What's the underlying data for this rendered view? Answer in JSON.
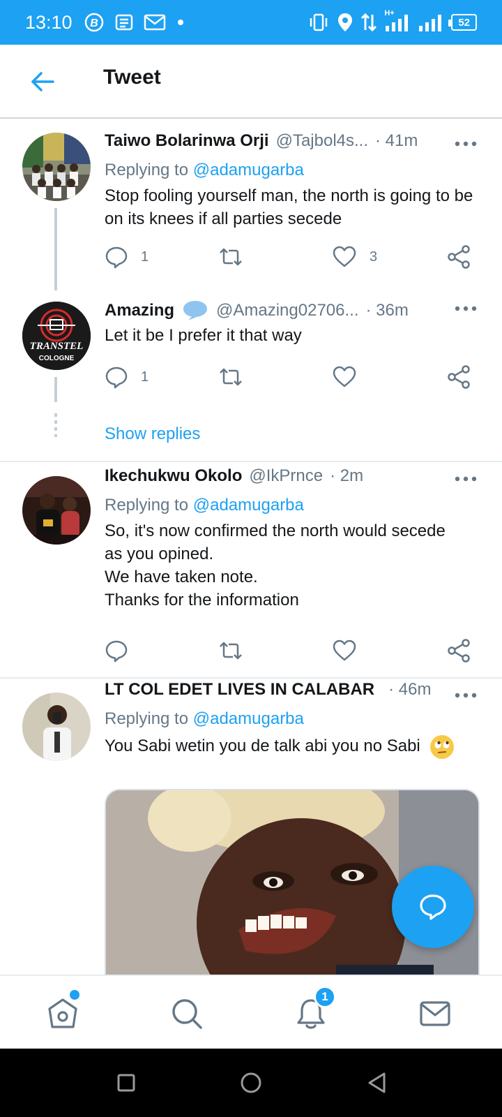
{
  "status_bar": {
    "time": "13:10",
    "battery": "52",
    "network": "H+"
  },
  "header": {
    "title": "Tweet"
  },
  "tweets": [
    {
      "name": "Taiwo Bolarinwa Orji",
      "handle": "@Tajbol4s...",
      "time": "· 41m",
      "replying_prefix": "Replying to ",
      "replying_to": "@adamugarba",
      "text": "Stop fooling yourself man, the north is going to be on its knees if all parties secede",
      "reply_count": "1",
      "retweet_count": "",
      "like_count": "3"
    },
    {
      "name": "Amazing",
      "handle": "@Amazing02706...",
      "time": "· 36m",
      "text": "Let it be I prefer it that way",
      "reply_count": "1",
      "retweet_count": "",
      "like_count": ""
    },
    {
      "name": "Ikechukwu Okolo",
      "handle": "@IkPrnce",
      "time": "· 2m",
      "replying_prefix": "Replying to ",
      "replying_to": "@adamugarba",
      "text_lines": [
        "So, it's now confirmed the north would secede",
        "as you opined.",
        "We have taken note.",
        "Thanks for the information"
      ],
      "reply_count": "",
      "retweet_count": "",
      "like_count": ""
    },
    {
      "name": "LT COL EDET LIVES IN CALABAR",
      "handle": "",
      "time": "· 46m",
      "replying_prefix": "Replying to ",
      "replying_to": "@adamugarba",
      "text": "You Sabi wetin you de talk abi you no Sabi"
    }
  ],
  "show_replies": "Show replies",
  "avatar_texts": {
    "transtel": "TRANSTEL",
    "cologne": "COLOGNE"
  },
  "bottom_nav": {
    "notification_badge": "1"
  },
  "colors": {
    "accent": "#1da1f2",
    "secondary_text": "#657786",
    "divider": "#e6ecf0"
  }
}
